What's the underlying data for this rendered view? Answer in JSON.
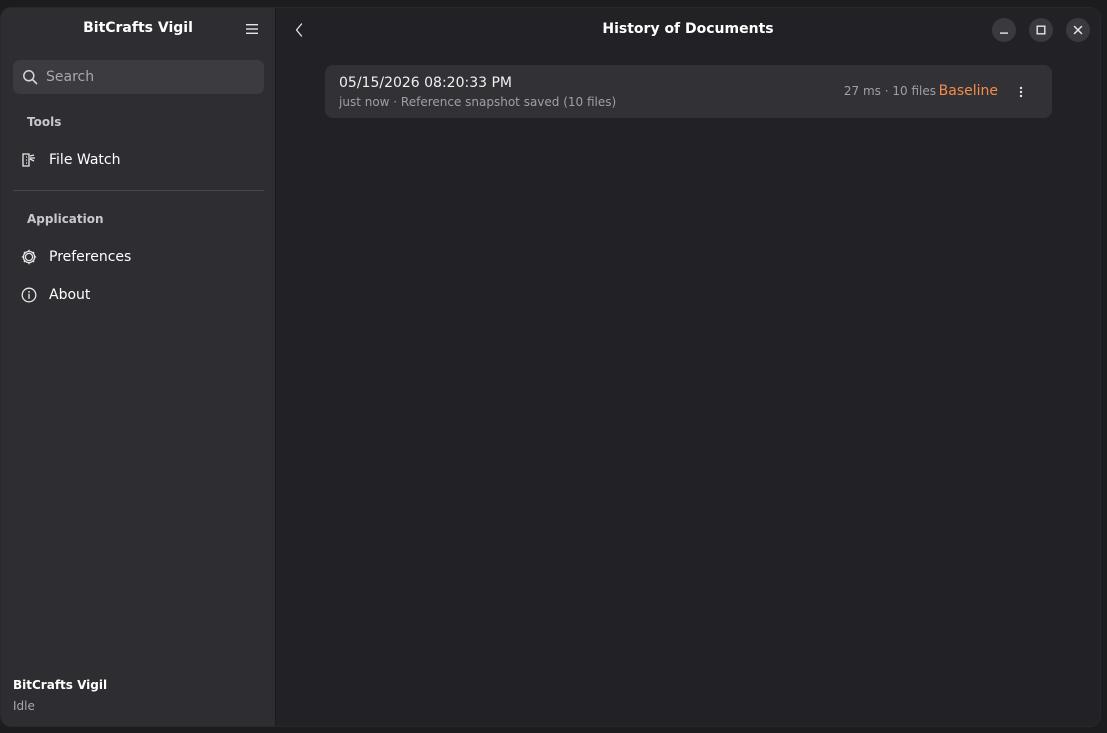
{
  "sidebar": {
    "app_title": "BitCrafts Vigil",
    "search_placeholder": "Search",
    "sections": [
      {
        "label": "Tools",
        "items": [
          {
            "label": "File Watch",
            "icon": "file-watch-icon"
          }
        ]
      },
      {
        "label": "Application",
        "items": [
          {
            "label": "Preferences",
            "icon": "gear-icon"
          },
          {
            "label": "About",
            "icon": "info-icon"
          }
        ]
      }
    ],
    "footer": {
      "title": "BitCrafts Vigil",
      "status": "Idle"
    }
  },
  "header": {
    "title": "History of Documents"
  },
  "history": [
    {
      "date": "05/15/2026 08:20:33 PM",
      "subtitle": "just now · Reference snapshot saved (10 files)",
      "meta": "27 ms · 10 files",
      "badge": "Baseline"
    }
  ],
  "colors": {
    "accent": "#f28c4b",
    "sidebar_bg": "#2e2e32",
    "main_bg": "#222226",
    "card_bg": "#323236"
  }
}
